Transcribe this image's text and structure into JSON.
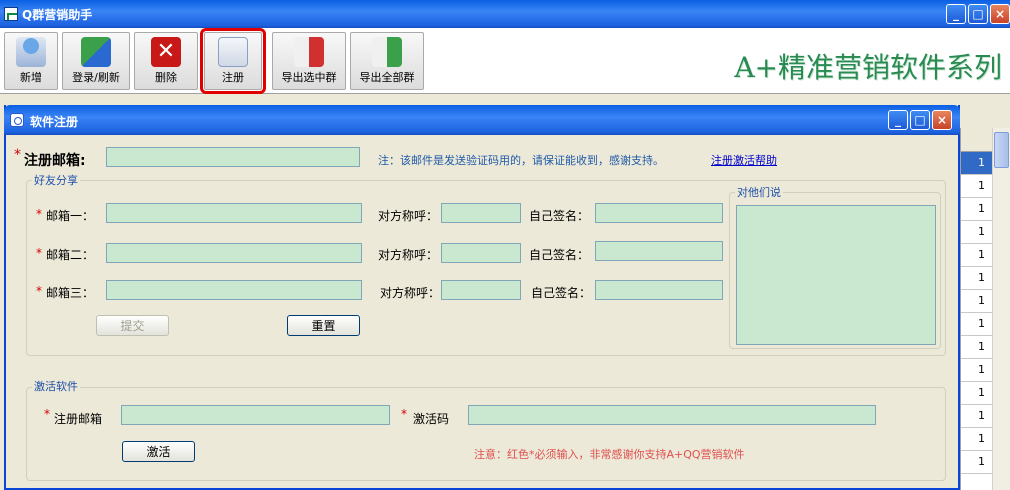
{
  "main_window": {
    "title": "Q群营销助手"
  },
  "toolbar": {
    "buttons": [
      {
        "label": "新增"
      },
      {
        "label": "登录/刷新"
      },
      {
        "label": "删除"
      },
      {
        "label": "注册"
      },
      {
        "label": "导出选中群"
      },
      {
        "label": "导出全部群"
      }
    ],
    "slogan": "A+精准营销软件系列"
  },
  "bg_grid": {
    "cell_value": "1"
  },
  "dialog": {
    "title": "软件注册",
    "register_email_label": "注册邮箱:",
    "register_email_value": "",
    "note": "注：该邮件是发送验证码用的，请保证能收到，感谢支持。",
    "help_link": "注册激活帮助",
    "share_group": {
      "legend": "好友分享",
      "rows": [
        {
          "email_label": "邮箱一：",
          "call_label": "对方称呼：",
          "sign_label": "自己签名："
        },
        {
          "email_label": "邮箱二：",
          "call_label": "对方称呼：",
          "sign_label": "自己签名："
        },
        {
          "email_label": "邮箱三：",
          "call_label": "对方称呼：",
          "sign_label": "自己签名："
        }
      ],
      "message_legend": "对他们说",
      "submit_label": "提交",
      "reset_label": "重置"
    },
    "activate_group": {
      "legend": "激活软件",
      "email_label": "注册邮箱",
      "code_label": "激活码",
      "activate_label": "激活",
      "warning": "注意：红色*必须输入，非常感谢你支持A+QQ营销软件"
    }
  },
  "colors": {
    "title_blue": "#0a5fe3",
    "field_green": "#c9e8cf",
    "required_red": "#d00000",
    "highlight_red": "#e00000",
    "slogan_green": "#2a8a52"
  },
  "icons": [
    "app-icon",
    "add-user-icon",
    "refresh-icon",
    "delete-icon",
    "register-icon",
    "export-selected-icon",
    "export-all-icon",
    "dialog-icon",
    "minimize-icon",
    "maximize-icon",
    "close-icon"
  ]
}
